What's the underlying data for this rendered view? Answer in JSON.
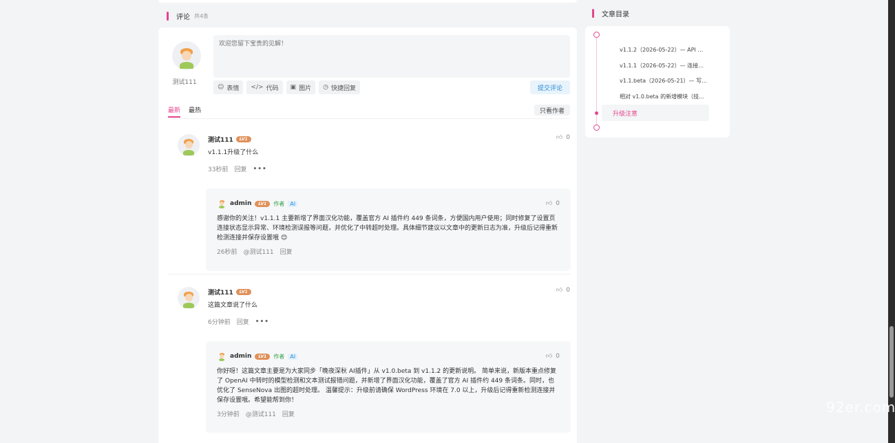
{
  "comments_section": {
    "title": "评论",
    "count": "共4条"
  },
  "editor": {
    "user_name": "测试111",
    "placeholder": "欢迎您留下宝贵的见解！",
    "tools": [
      {
        "icon": "smile-icon",
        "glyph": "☺",
        "label": "表情"
      },
      {
        "icon": "code-icon",
        "glyph": "</>",
        "label": "代码"
      },
      {
        "icon": "image-icon",
        "glyph": "▣",
        "label": "图片"
      },
      {
        "icon": "quick-reply-icon",
        "glyph": "◷",
        "label": "快捷回复"
      }
    ],
    "submit_label": "提交评论"
  },
  "tabs": {
    "latest": "最新",
    "hottest": "最热",
    "author_only": "只看作者"
  },
  "comments": [
    {
      "name": "测试111",
      "level": "LV1",
      "text": "v1.1.1升级了什么",
      "time": "33秒前",
      "reply_label": "回复",
      "likes": "0",
      "reply": {
        "name": "admin",
        "level": "LV1",
        "author_tag": "作者",
        "ai_tag": "AI",
        "likes": "0",
        "text": "感谢你的关注！v1.1.1 主要新增了界面汉化功能，覆盖官方 AI 插件约 449 条词条，方便国内用户使用；同时修复了设置页连接状态显示异常、环境检测误报等问题，并优化了中转超时处理。具体细节建议以文章中的更新日志为准，升级后记得重新检测连接并保存设置哦 😊",
        "time": "26秒前",
        "mention": "@测试111",
        "reply_label": "回复"
      }
    },
    {
      "name": "测试111",
      "level": "LV1",
      "text": "这篇文章说了什么",
      "time": "6分钟前",
      "reply_label": "回复",
      "likes": "0",
      "reply": {
        "name": "admin",
        "level": "LV1",
        "author_tag": "作者",
        "ai_tag": "AI",
        "likes": "0",
        "text": "你好呀！这篇文章主要是为大家同步「晚夜深秋 AI插件」从 v1.0.beta 到 v1.1.2 的更新说明。 简单来说，新版本重点修复了 OpenAI 中转时的模型检测和文本测试报错问题，并新增了界面汉化功能，覆盖了官方 AI 插件约 449 条词条。同时，也优化了 SenseNova 出图的超时处理。 温馨提示：升级前请确保 WordPress 环境在 7.0 以上，升级后记得重新检测连接并保存设置哦。希望能帮到你！",
        "time": "3分钟前",
        "mention": "@测试111",
        "reply_label": "回复"
      }
    }
  ],
  "toc": {
    "title": "文章目录",
    "items": [
      "v1.1.2（2026-05-22）— API …",
      "v1.1.1（2026-05-22）— 连接…",
      "v1.1.beta（2026-05-21）— 写…",
      "相对 v1.0.beta 的新增模块（技…"
    ],
    "active": "升级注意"
  },
  "watermark": "92er.com",
  "colors": {
    "accent": "#e4458c",
    "link_blue": "#2a8bd8",
    "author_green": "#2e9e46",
    "level_badge": "#e0905a"
  }
}
